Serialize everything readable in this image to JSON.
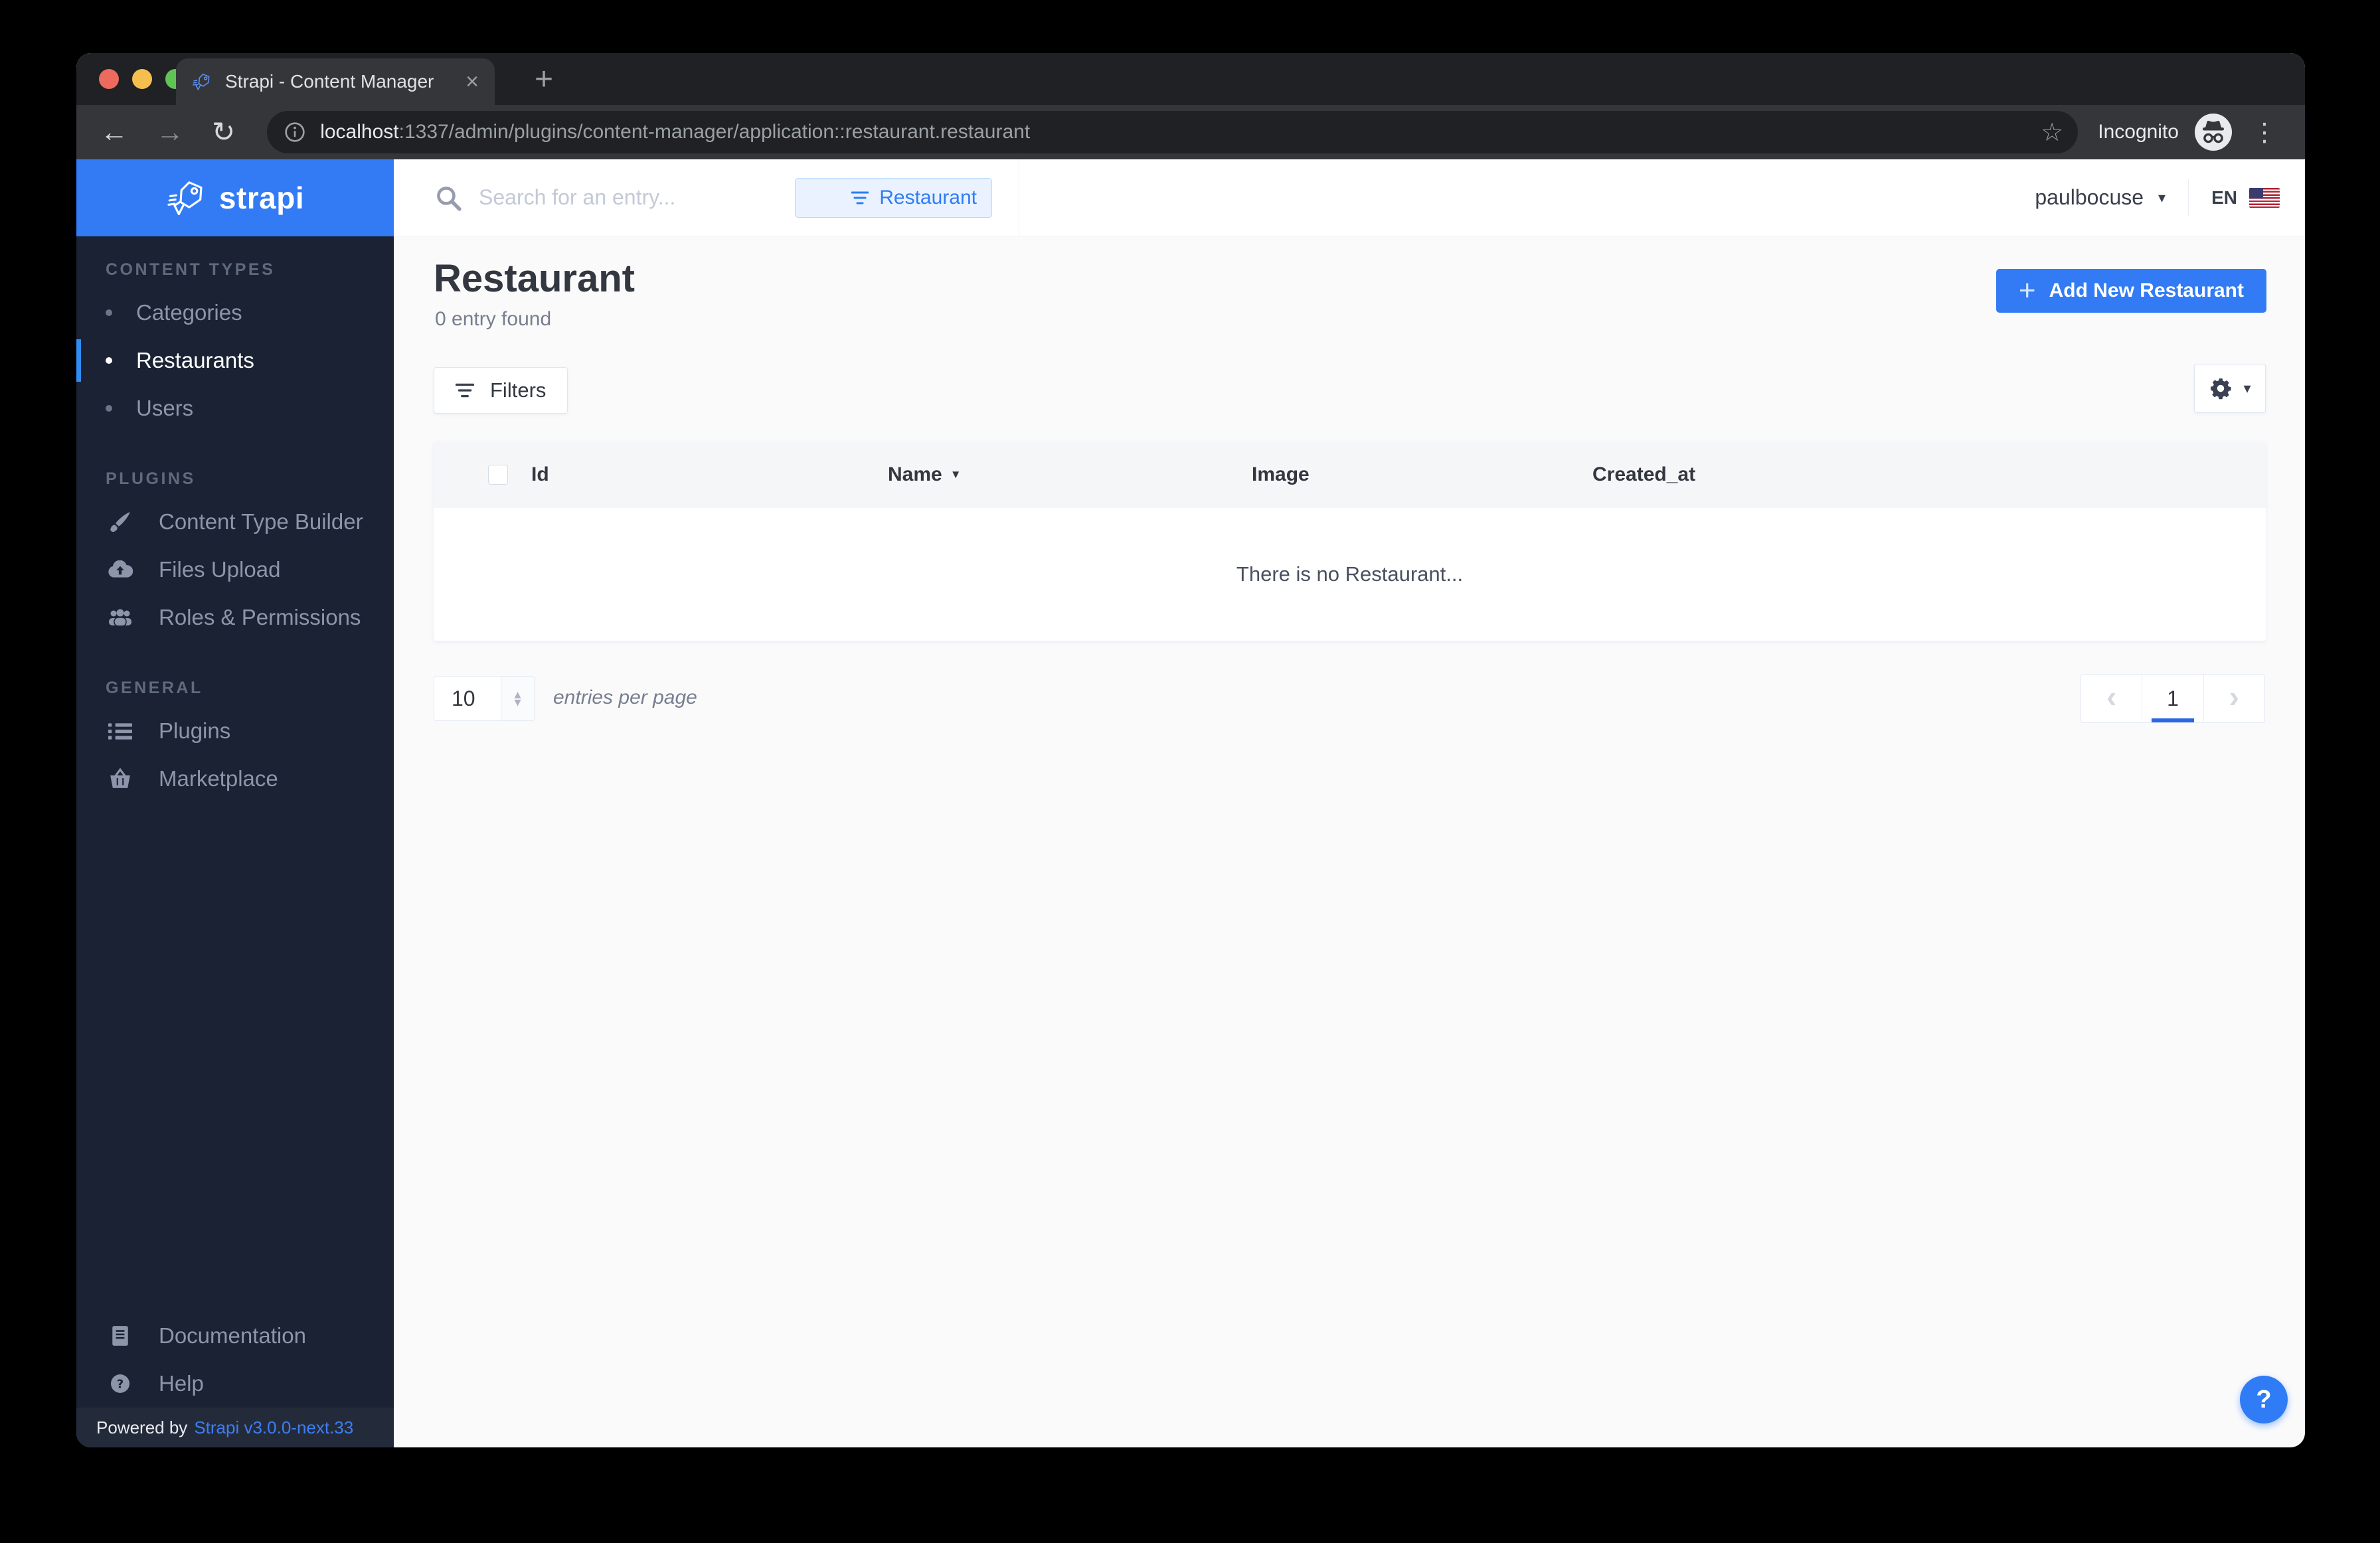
{
  "browser": {
    "tab_title": "Strapi - Content Manager",
    "url_host": "localhost",
    "url_rest": ":1337/admin/plugins/content-manager/application::restaurant.restaurant",
    "incognito_label": "Incognito"
  },
  "header": {
    "search_placeholder": "Search for an entry...",
    "filter_chip": "Restaurant",
    "user": "paulbocuse",
    "locale": "EN"
  },
  "sidebar": {
    "logo_text": "strapi",
    "sections": [
      {
        "label": "CONTENT TYPES",
        "items": [
          {
            "label": "Categories",
            "active": false
          },
          {
            "label": "Restaurants",
            "active": true
          },
          {
            "label": "Users",
            "active": false
          }
        ]
      },
      {
        "label": "PLUGINS",
        "items": [
          {
            "label": "Content Type Builder",
            "icon": "paintbrush-icon"
          },
          {
            "label": "Files Upload",
            "icon": "cloud-upload-icon"
          },
          {
            "label": "Roles & Permissions",
            "icon": "users-icon"
          }
        ]
      },
      {
        "label": "GENERAL",
        "items": [
          {
            "label": "Plugins",
            "icon": "list-icon"
          },
          {
            "label": "Marketplace",
            "icon": "basket-icon"
          }
        ]
      }
    ],
    "footer_links": [
      {
        "label": "Documentation",
        "icon": "book-icon"
      },
      {
        "label": "Help",
        "icon": "question-icon"
      }
    ],
    "powered_by": {
      "prefix": "Powered by",
      "link": "Strapi v3.0.0-next.33"
    }
  },
  "content": {
    "title": "Restaurant",
    "subtitle": "0 entry found",
    "add_button": "Add New Restaurant",
    "filters_button": "Filters",
    "table": {
      "columns": [
        "Id",
        "Name",
        "Image",
        "Created_at"
      ],
      "sorted_column": "Name",
      "rows": [],
      "empty_message": "There is no Restaurant..."
    },
    "pagination": {
      "per_page": "10",
      "per_page_label": "entries per page",
      "current_page": "1"
    }
  },
  "icons": {
    "back": "←",
    "forward": "→",
    "reload": "↻",
    "star": "☆",
    "menu_dots": "⋮",
    "close_tab": "×",
    "new_tab": "+",
    "caret_down": "▾",
    "sort_desc": "▼",
    "chevron_left": "‹",
    "chevron_right": "›",
    "plus": "+",
    "stepper_up": "▴",
    "stepper_down": "▾",
    "help": "?"
  },
  "colors": {
    "accent_blue": "#327BF5",
    "link_blue": "#3E7EF2",
    "chip_blue_text": "#2E7CF7",
    "chip_blue_bg": "#E9F2FE",
    "sidebar_bg": "#1A2233",
    "sidebar_footer_bg": "#232B3B",
    "page_bg": "#FAFAFB",
    "table_header_bg": "#F5F6F7",
    "text_dark": "#333740",
    "text_gray": "#787E8F",
    "border": "#E3E9F3",
    "chrome_dark": "#202124",
    "chrome_toolbar": "#35363A"
  }
}
